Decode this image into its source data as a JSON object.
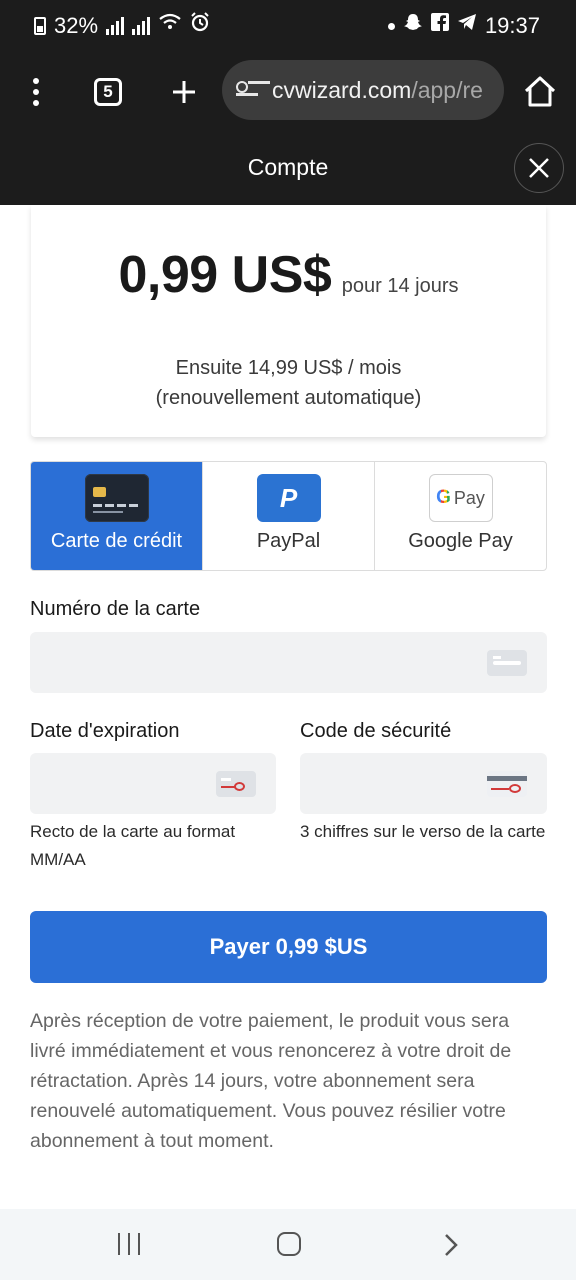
{
  "status_bar": {
    "battery": "32%",
    "time": "19:37",
    "icons": [
      "battery-icon",
      "signal-icon",
      "signal-icon",
      "wifi-icon",
      "alarm-icon",
      "notification-dot-icon",
      "snapchat-icon",
      "facebook-icon",
      "telegram-icon"
    ]
  },
  "browser": {
    "tab_count": "5",
    "url_domain": "cvwizard.com",
    "url_path": "/app/re",
    "icons": [
      "menu-dots-icon",
      "tabs-icon",
      "plus-icon",
      "site-settings-icon",
      "home-icon"
    ]
  },
  "sheet": {
    "title": "Compte",
    "close_icon": "close-icon"
  },
  "price": {
    "amount": "0,99 US$",
    "period": "pour 14 jours",
    "after_line1": "Ensuite 14,99 US$ / mois",
    "after_line2": "(renouvellement automatique)"
  },
  "payment_methods": [
    {
      "label": "Carte de crédit",
      "icon": "credit-card-icon",
      "active": true
    },
    {
      "label": "PayPal",
      "icon": "paypal-icon",
      "active": false
    },
    {
      "label": "Google Pay",
      "icon": "google-pay-icon",
      "active": false
    }
  ],
  "gpay_logo_text": "Pay",
  "paypal_logo_text": "P",
  "form": {
    "card_number_label": "Numéro de la carte",
    "card_number_value": "",
    "expiry_label": "Date d'expiration",
    "expiry_value": "",
    "expiry_hint": "Recto de la carte au format MM/AA",
    "cvc_label": "Code de sécurité",
    "cvc_value": "",
    "cvc_hint": "3 chiffres sur le verso de la carte"
  },
  "pay_button_label": "Payer 0,99 $US",
  "disclaimer": "Après réception de votre paiement, le produit vous sera livré immédiatement et vous renoncerez à votre droit de rétractation. Après 14 jours, votre abonnement sera renouvelé automatiquement. Vous pouvez résilier votre abonnement à tout moment.",
  "colors": {
    "accent": "#2b6fd6",
    "toolbar": "#1c1c1c",
    "input_bg": "#f1f2f3",
    "paypal": "#2b73d2",
    "cvv_mark": "#d23a3a"
  },
  "nav": {
    "icons": [
      "recents-icon",
      "home-nav-icon",
      "back-icon"
    ]
  }
}
